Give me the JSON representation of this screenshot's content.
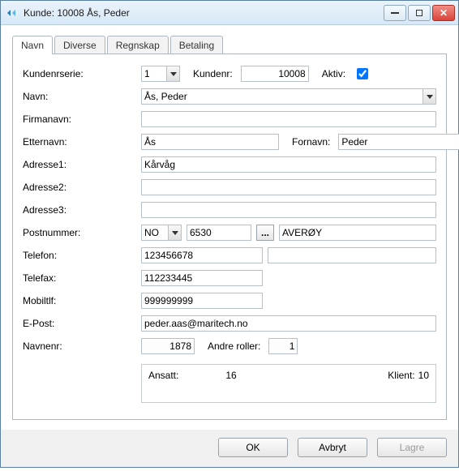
{
  "window": {
    "title": "Kunde:  10008  Ås, Peder"
  },
  "tabs": [
    {
      "label": "Navn"
    },
    {
      "label": "Diverse"
    },
    {
      "label": "Regnskap"
    },
    {
      "label": "Betaling"
    }
  ],
  "labels": {
    "kundenrserie": "Kundenrserie:",
    "kundenr": "Kundenr:",
    "aktiv": "Aktiv:",
    "navn": "Navn:",
    "firmanavn": "Firmanavn:",
    "etternavn": "Etternavn:",
    "fornavn": "Fornavn:",
    "adresse1": "Adresse1:",
    "adresse2": "Adresse2:",
    "adresse3": "Adresse3:",
    "postnummer": "Postnummer:",
    "telefon": "Telefon:",
    "telefax": "Telefax:",
    "mobiltlf": "Mobiltlf:",
    "epost": "E-Post:",
    "navnenr": "Navnenr:",
    "andre_roller": "Andre roller:",
    "ansatt": "Ansatt:",
    "klient": "Klient:"
  },
  "values": {
    "kundenrserie": "1",
    "kundenr": "10008",
    "aktiv": true,
    "navn": "Ås, Peder",
    "firmanavn": "",
    "etternavn": "Ås",
    "fornavn": "Peder",
    "adresse1": "Kårvåg",
    "adresse2": "",
    "adresse3": "",
    "post_land": "NO",
    "post_nr": "6530",
    "post_sted": "AVERØY",
    "telefon": "123456678",
    "telefon2": "",
    "telefax": "112233445",
    "mobiltlf": "999999999",
    "epost": "peder.aas@maritech.no",
    "navnenr": "1878",
    "andre_roller": "1",
    "ansatt_nr": "16",
    "klient_nr": "10"
  },
  "buttons": {
    "ok": "OK",
    "avbryt": "Avbryt",
    "lagre": "Lagre",
    "ellipsis": "..."
  }
}
